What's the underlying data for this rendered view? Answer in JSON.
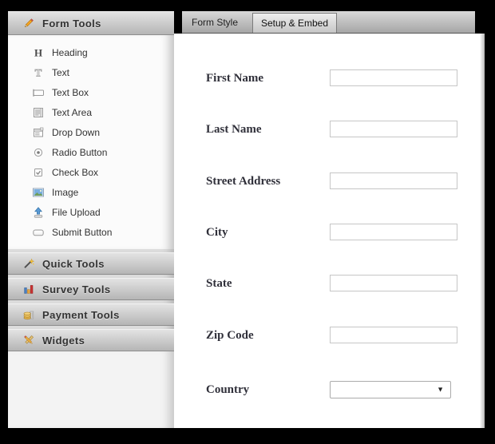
{
  "colors": {
    "frame": "#000000",
    "sidebar_header_top": "#e3e3e3",
    "sidebar_header_bottom": "#b5b5b5",
    "tool_list_bg": "#fbfbfb",
    "panel_bg": "#ffffff",
    "tabbar_top": "#d8d8d8",
    "tabbar_bottom": "#a6a6a6",
    "form_label_text": "#30303a",
    "pencil_orange": "#f5a623",
    "upload_blue": "#5b9bd5",
    "chart_blue": "#4a7fc1",
    "chart_red": "#cc3333",
    "coin_gold": "#e0b14d"
  },
  "sidebar": {
    "sections": [
      {
        "label": "Form Tools",
        "icon": "pencil-icon",
        "expanded": true,
        "items": [
          {
            "label": "Heading",
            "icon": "heading-icon"
          },
          {
            "label": "Text",
            "icon": "text-icon"
          },
          {
            "label": "Text Box",
            "icon": "textbox-icon"
          },
          {
            "label": "Text Area",
            "icon": "textarea-icon"
          },
          {
            "label": "Drop Down",
            "icon": "dropdown-icon"
          },
          {
            "label": "Radio Button",
            "icon": "radio-icon"
          },
          {
            "label": "Check Box",
            "icon": "checkbox-icon"
          },
          {
            "label": "Image",
            "icon": "image-icon"
          },
          {
            "label": "File Upload",
            "icon": "upload-icon"
          },
          {
            "label": "Submit Button",
            "icon": "button-icon"
          }
        ]
      },
      {
        "label": "Quick Tools",
        "icon": "wand-icon",
        "expanded": false
      },
      {
        "label": "Survey Tools",
        "icon": "bar-chart-icon",
        "expanded": false
      },
      {
        "label": "Payment Tools",
        "icon": "coins-icon",
        "expanded": false
      },
      {
        "label": "Widgets",
        "icon": "widgets-icon",
        "expanded": false
      }
    ]
  },
  "tabs": [
    {
      "label": "Form Style",
      "active": false
    },
    {
      "label": "Setup & Embed",
      "active": true
    }
  ],
  "form": {
    "fields": [
      {
        "label": "First Name",
        "type": "text",
        "value": ""
      },
      {
        "label": "Last Name",
        "type": "text",
        "value": ""
      },
      {
        "label": "Street Address",
        "type": "text",
        "value": ""
      },
      {
        "label": "City",
        "type": "text",
        "value": ""
      },
      {
        "label": "State",
        "type": "text",
        "value": ""
      },
      {
        "label": "Zip Code",
        "type": "text",
        "value": ""
      },
      {
        "label": "Country",
        "type": "select",
        "value": ""
      }
    ]
  }
}
